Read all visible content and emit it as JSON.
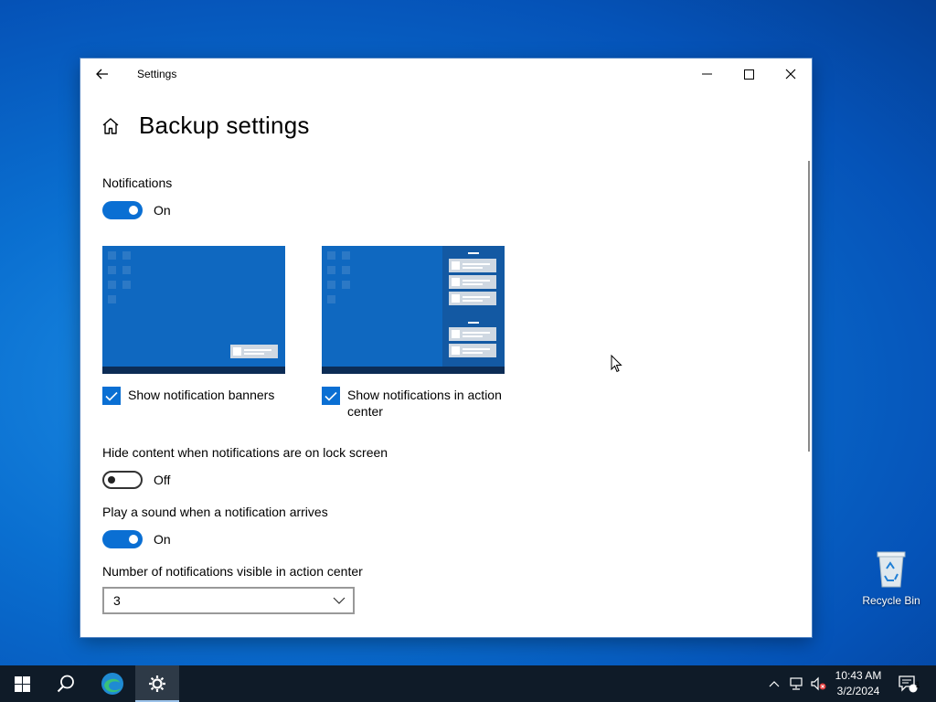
{
  "desktop": {
    "icons": [
      {
        "label": "Recycle Bin",
        "icon": "recycle-bin-icon"
      }
    ]
  },
  "window": {
    "title": "Settings",
    "page_title": "Backup settings",
    "controls": {
      "minimize": "minimize-icon",
      "maximize": "maximize-icon",
      "close": "close-icon"
    }
  },
  "notifications": {
    "label": "Notifications",
    "toggle_state": "On",
    "options": [
      {
        "label": "Show notification banners",
        "checked": true
      },
      {
        "label": "Show notifications in action center",
        "checked": true
      }
    ]
  },
  "lock_screen": {
    "label": "Hide content when notifications are on lock screen",
    "toggle_state": "Off"
  },
  "sound": {
    "label": "Play a sound when a notification arrives",
    "toggle_state": "On"
  },
  "visible_count": {
    "label": "Number of notifications visible in action center",
    "value": "3"
  },
  "taskbar": {
    "pinned": [
      "start-icon",
      "search-icon",
      "edge-icon",
      "settings-icon"
    ],
    "time": "10:43 AM",
    "date": "3/2/2024",
    "notification_count": "1"
  },
  "colors": {
    "accent": "#0a6fd3",
    "taskbar": "#0f1b28"
  }
}
